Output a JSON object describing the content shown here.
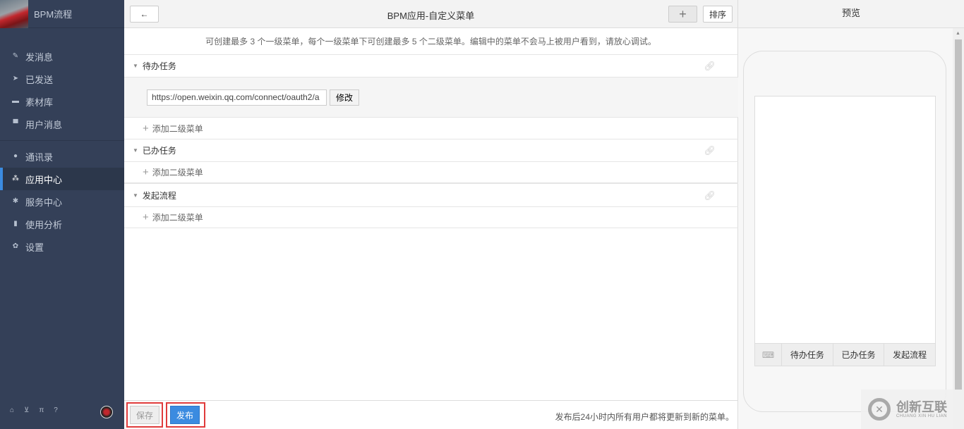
{
  "sidebar": {
    "title": "BPM流程",
    "items": [
      {
        "label": "发消息",
        "icon": "✎"
      },
      {
        "label": "已发送",
        "icon": "➤"
      },
      {
        "label": "素材库",
        "icon": "▬"
      },
      {
        "label": "用户消息",
        "icon": "▀"
      },
      {
        "label": "通讯录",
        "icon": "●"
      },
      {
        "label": "应用中心",
        "icon": "⁂"
      },
      {
        "label": "服务中心",
        "icon": "✱"
      },
      {
        "label": "使用分析",
        "icon": "▮"
      },
      {
        "label": "设置",
        "icon": "✿"
      }
    ],
    "footer_icons": [
      "home-icon",
      "cart-icon",
      "currency-icon",
      "help-icon"
    ]
  },
  "header": {
    "title": "BPM应用-自定义菜单",
    "back": "←",
    "add": "+",
    "sort": "排序"
  },
  "notice": "可创建最多 3 个一级菜单，每个一级菜单下可创建最多 5 个二级菜单。编辑中的菜单不会马上被用户看到，请放心调试。",
  "menus": [
    {
      "name": "待办任务",
      "url": "https://open.weixin.qq.com/connect/oauth2/a",
      "edit": "修改"
    },
    {
      "name": "已办任务"
    },
    {
      "name": "发起流程"
    }
  ],
  "add_sub": "添加二级菜单",
  "footer": {
    "save": "保存",
    "publish": "发布",
    "hint": "发布后24小时内所有用户都将更新到新的菜单。"
  },
  "preview": {
    "title": "预览",
    "items": [
      "待办任务",
      "已办任务",
      "发起流程"
    ]
  },
  "watermark": {
    "name": "创新互联",
    "sub": "CHUANG XIN HU LIAN"
  }
}
